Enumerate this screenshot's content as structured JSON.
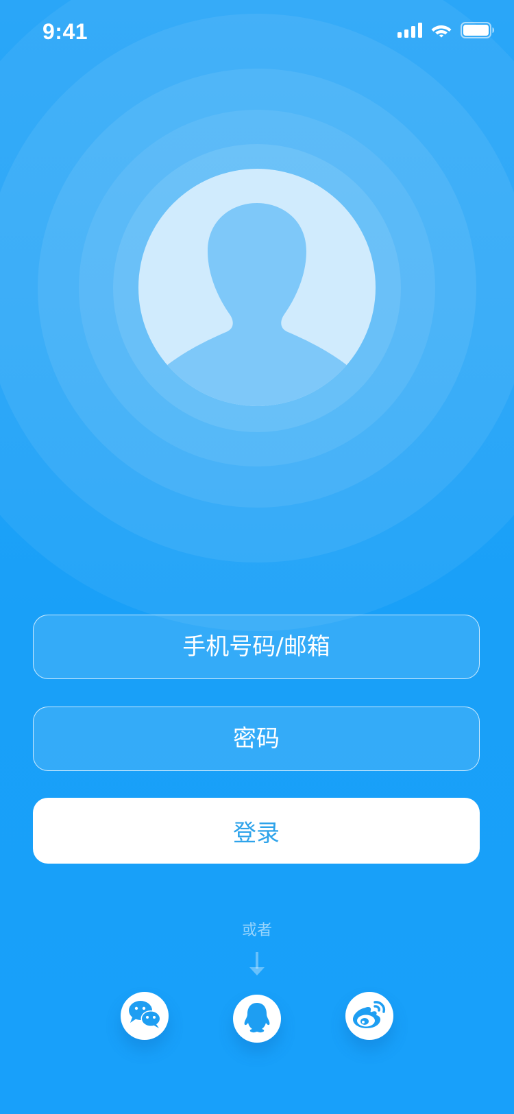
{
  "status_bar": {
    "time": "9:41",
    "icons": [
      "cellular-signal-icon",
      "wifi-icon",
      "battery-icon"
    ]
  },
  "avatar": {
    "icon": "user-silhouette-icon"
  },
  "login_form": {
    "phone_email_placeholder": "手机号码/邮箱",
    "password_placeholder": "密码",
    "login_label": "登录"
  },
  "alternative_login": {
    "or_text": "或者",
    "icons": [
      "down-arrow-icon",
      "wechat-icon",
      "qq-icon",
      "weibo-icon"
    ]
  },
  "colors": {
    "background": "#19a0f8",
    "accent": "#2ea3ea",
    "white": "#ffffff"
  }
}
